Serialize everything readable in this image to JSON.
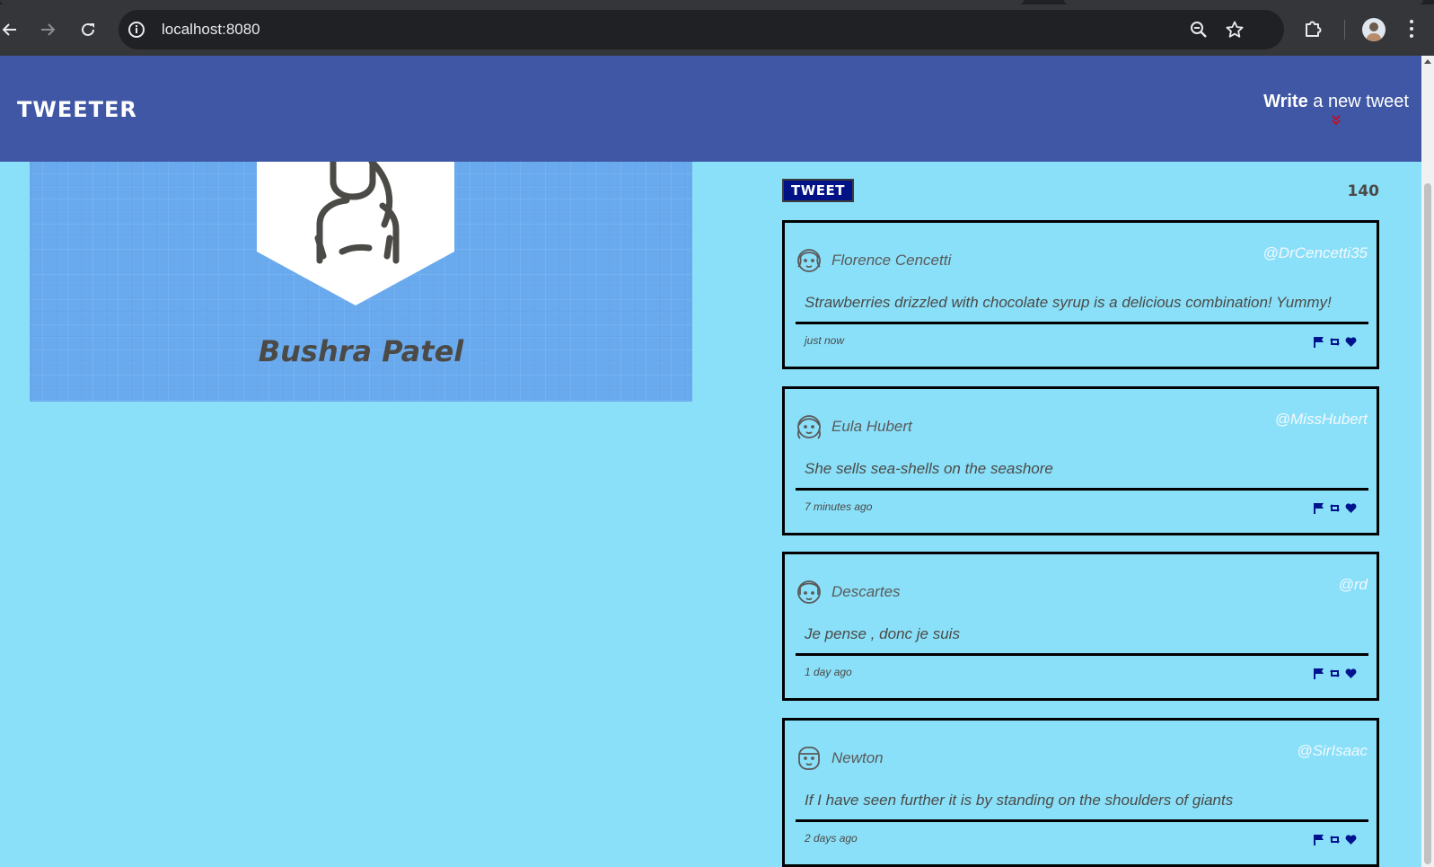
{
  "browser": {
    "url": "localhost:8080"
  },
  "header": {
    "brand": "TWEETER",
    "compose_bold": "Write",
    "compose_rest": " a new tweet"
  },
  "profile": {
    "name": "Bushra Patel"
  },
  "composer": {
    "button_label": "TWEET",
    "counter": "140"
  },
  "tweets": [
    {
      "name": "Florence Cencetti",
      "handle": "@DrCencetti35",
      "content": "Strawberries drizzled with chocolate syrup is a delicious combination! Yummy!",
      "time": "just now"
    },
    {
      "name": "Eula Hubert",
      "handle": "@MissHubert",
      "content": "She sells sea-shells on the seashore",
      "time": "7 minutes ago"
    },
    {
      "name": "Descartes",
      "handle": "@rd",
      "content": "Je pense , donc je suis",
      "time": "1 day ago"
    },
    {
      "name": "Newton",
      "handle": "@SirIsaac",
      "content": "If I have seen further it is by standing on the shoulders of giants",
      "time": "2 days ago"
    }
  ],
  "icons": {
    "flag": "flag-icon",
    "retweet": "retweet-icon",
    "like": "heart-icon"
  },
  "colors": {
    "header_bg": "#3f57a4",
    "page_bg": "#8ae0f9",
    "tweet_button_bg": "#001286",
    "action_icon": "#00138f",
    "chevron": "#c0102a"
  }
}
